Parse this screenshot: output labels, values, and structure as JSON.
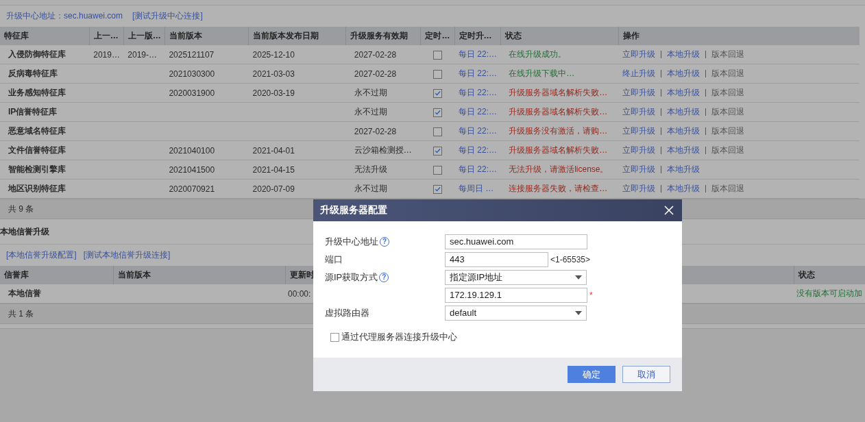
{
  "upgrade_center": {
    "address": "升级中心地址：sec.huawei.com",
    "test_link": "[测试升级中心连接]"
  },
  "signature_table": {
    "columns": [
      "特征库",
      "上一…",
      "上一版…",
      "当前版本",
      "当前版本发布日期",
      "升级服务有效期",
      "定时…",
      "定时升…",
      "状态",
      "操作"
    ],
    "rows": [
      {
        "name": "入侵防御特征库",
        "prev": "2019…",
        "prev_date": "2019-…",
        "version": "2025121107",
        "release_date": "2025-12-10",
        "validity": "2027-02-28",
        "scheduled": false,
        "schedule": "每日 22:…",
        "status": {
          "text": "在线升级成功。",
          "color": "#226b35"
        },
        "actions": [
          {
            "label": "立即升级",
            "disabled": false
          },
          {
            "label": "本地升级",
            "disabled": false
          },
          {
            "label": "版本回退",
            "disabled": true
          }
        ]
      },
      {
        "name": "反病毒特征库",
        "version": "2021030300",
        "release_date": "2021-03-03",
        "validity": "2027-02-28",
        "scheduled": false,
        "schedule": "每日 22:…",
        "status": {
          "text": "在线升级下载中…",
          "color": "#226b35"
        },
        "actions": [
          {
            "label": "终止升级",
            "disabled": false
          },
          {
            "label": "本地升级",
            "disabled": false
          },
          {
            "label": "版本回退",
            "disabled": true
          }
        ]
      },
      {
        "name": "业务感知特征库",
        "version": "2020031900",
        "release_date": "2020-03-19",
        "validity": "永不过期",
        "scheduled": true,
        "schedule": "每日 22:…",
        "status": {
          "text": "升级服务器域名解析失败…",
          "color": "#93291f"
        },
        "actions": [
          {
            "label": "立即升级",
            "disabled": false
          },
          {
            "label": "本地升级",
            "disabled": false
          },
          {
            "label": "版本回退",
            "disabled": true
          }
        ]
      },
      {
        "name": "IP信誉特征库",
        "validity": "永不过期",
        "scheduled": true,
        "schedule": "每日 22:…",
        "status": {
          "text": "升级服务器域名解析失败…",
          "color": "#93291f"
        },
        "actions": [
          {
            "label": "立即升级",
            "disabled": false
          },
          {
            "label": "本地升级",
            "disabled": false
          },
          {
            "label": "版本回退",
            "disabled": true
          }
        ]
      },
      {
        "name": "恶意域名特征库",
        "validity": "2027-02-28",
        "scheduled": false,
        "schedule": "每日 22:…",
        "status": {
          "text": "升级服务没有激活，请购…",
          "color": "#93291f"
        },
        "actions": [
          {
            "label": "立即升级",
            "disabled": false
          },
          {
            "label": "本地升级",
            "disabled": false
          },
          {
            "label": "版本回退",
            "disabled": true
          }
        ]
      },
      {
        "name": "文件信誉特征库",
        "version": "2021040100",
        "release_date": "2021-04-01",
        "validity": "云沙箱检测授…",
        "scheduled": true,
        "schedule": "每日 22:…",
        "status": {
          "text": "升级服务器域名解析失败…",
          "color": "#93291f"
        },
        "actions": [
          {
            "label": "立即升级",
            "disabled": false
          },
          {
            "label": "本地升级",
            "disabled": false
          },
          {
            "label": "版本回退",
            "disabled": true
          }
        ]
      },
      {
        "name": "智能检测引擎库",
        "version": "2021041500",
        "release_date": "2021-04-15",
        "validity": "无法升级",
        "scheduled": false,
        "schedule": "每日 22:…",
        "status": {
          "text": "无法升级，请激活license。",
          "color": "#93291f"
        },
        "actions": [
          {
            "label": "立即升级",
            "disabled": false
          },
          {
            "label": "本地升级",
            "disabled": false
          }
        ]
      },
      {
        "name": "地区识别特征库",
        "version": "2020070921",
        "release_date": "2020-07-09",
        "validity": "永不过期",
        "scheduled": true,
        "schedule": "每周日 …",
        "status": {
          "text": "连接服务器失败，请检查…",
          "color": "#93291f"
        },
        "actions": [
          {
            "label": "立即升级",
            "disabled": false
          },
          {
            "label": "本地升级",
            "disabled": false
          },
          {
            "label": "版本回退",
            "disabled": true
          }
        ]
      }
    ],
    "footer": "共 9 条"
  },
  "reputation_section": {
    "title": "本地信誉升级",
    "links": [
      "[本地信誉升级配置]",
      "[测试本地信誉升级连接]"
    ],
    "columns": [
      "信誉库",
      "当前版本",
      "更新时",
      "状态"
    ],
    "rows": [
      {
        "name": "本地信誉",
        "column_3": "00:00:",
        "status": "没有版本可启动加"
      }
    ],
    "footer": "共 1 条"
  },
  "dialog": {
    "title": "升级服务器配置",
    "fields": [
      {
        "kind": "text",
        "label": "升级中心地址",
        "help": "?",
        "value": "sec.huawei.com"
      },
      {
        "kind": "text",
        "label": "端口",
        "value": "443",
        "hint": "<1-65535>"
      },
      {
        "kind": "select",
        "label": "源IP获取方式",
        "help": "?",
        "value": "指定源IP地址"
      },
      {
        "kind": "text",
        "value": "172.19.129.1",
        "required_mark": "*"
      },
      {
        "kind": "select",
        "label": "虚拟路由器",
        "value": "default"
      }
    ],
    "proxy_checkbox": {
      "label": "通过代理服务器连接升级中心",
      "checked": false
    },
    "buttons": [
      {
        "label": "确定",
        "kind": "primary"
      },
      {
        "label": "取消",
        "kind": "secondary"
      }
    ]
  }
}
